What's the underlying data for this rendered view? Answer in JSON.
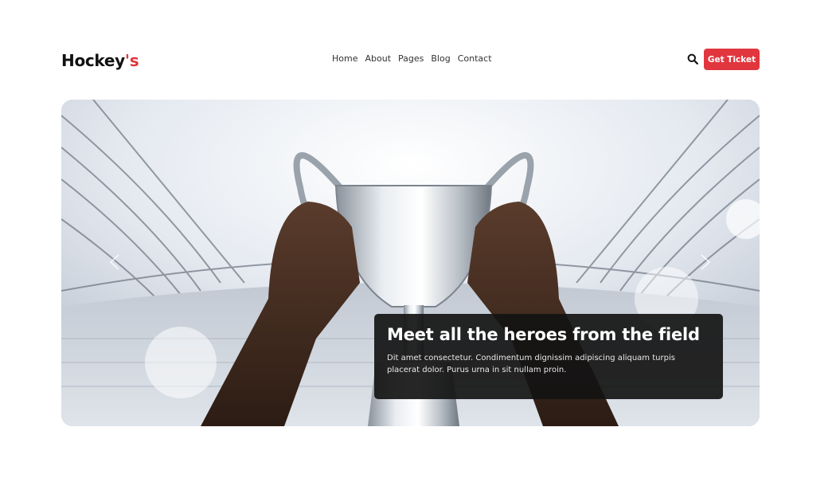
{
  "header": {
    "logo_main": "Hockey",
    "logo_accent": "'s",
    "nav": [
      "Home",
      "About",
      "Pages",
      "Blog",
      "Contact"
    ],
    "search_icon": "search-icon",
    "cta_label": "Get Ticket"
  },
  "hero": {
    "title": "Meet all the heroes from the field",
    "description": "Dit amet consectetur. Condimentum dignissim adipiscing aliquam turpis placerat dolor. Purus urna in sit nullam proin.",
    "prev_icon": "chevron-left-icon",
    "next_icon": "chevron-right-icon"
  },
  "colors": {
    "accent": "#e2363f",
    "caption_bg": "#141414"
  }
}
